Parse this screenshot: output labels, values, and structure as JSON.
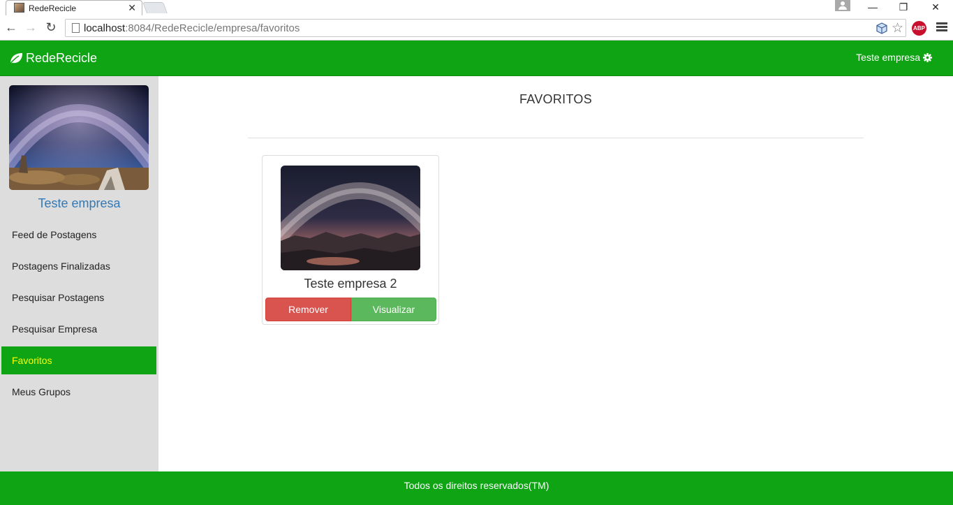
{
  "browser": {
    "tab_title": "RedeRecicle",
    "tab_close": "✕",
    "url_host": "localhost",
    "url_rest": ":8084/RedeRecicle/empresa/favoritos",
    "star": "☆",
    "abp": "ABP",
    "minimize": "—",
    "restore": "❐",
    "close": "✕",
    "back": "←",
    "forward": "→",
    "reload": "↻"
  },
  "app": {
    "brand": "RedeRecicle",
    "user_name": "Teste empresa",
    "colors": {
      "primary": "#0ea414",
      "active_text": "#ffff00",
      "link": "#337ab7",
      "danger": "#d9534f",
      "success": "#5cb85c"
    }
  },
  "sidebar": {
    "profile_name": "Teste empresa",
    "items": [
      {
        "label": "Feed de Postagens"
      },
      {
        "label": "Postagens Finalizadas"
      },
      {
        "label": "Pesquisar Postagens"
      },
      {
        "label": "Pesquisar Empresa"
      },
      {
        "label": "Favoritos",
        "active": true
      },
      {
        "label": "Meus Grupos"
      }
    ]
  },
  "main": {
    "title": "FAVORITOS",
    "favorites": [
      {
        "name": "Teste empresa 2",
        "remove_label": "Remover",
        "view_label": "Visualizar"
      }
    ]
  },
  "footer": {
    "text": "Todos os direitos reservados(TM)"
  },
  "icons": {
    "brand": "leaf-icon",
    "user": "gear-icon"
  }
}
